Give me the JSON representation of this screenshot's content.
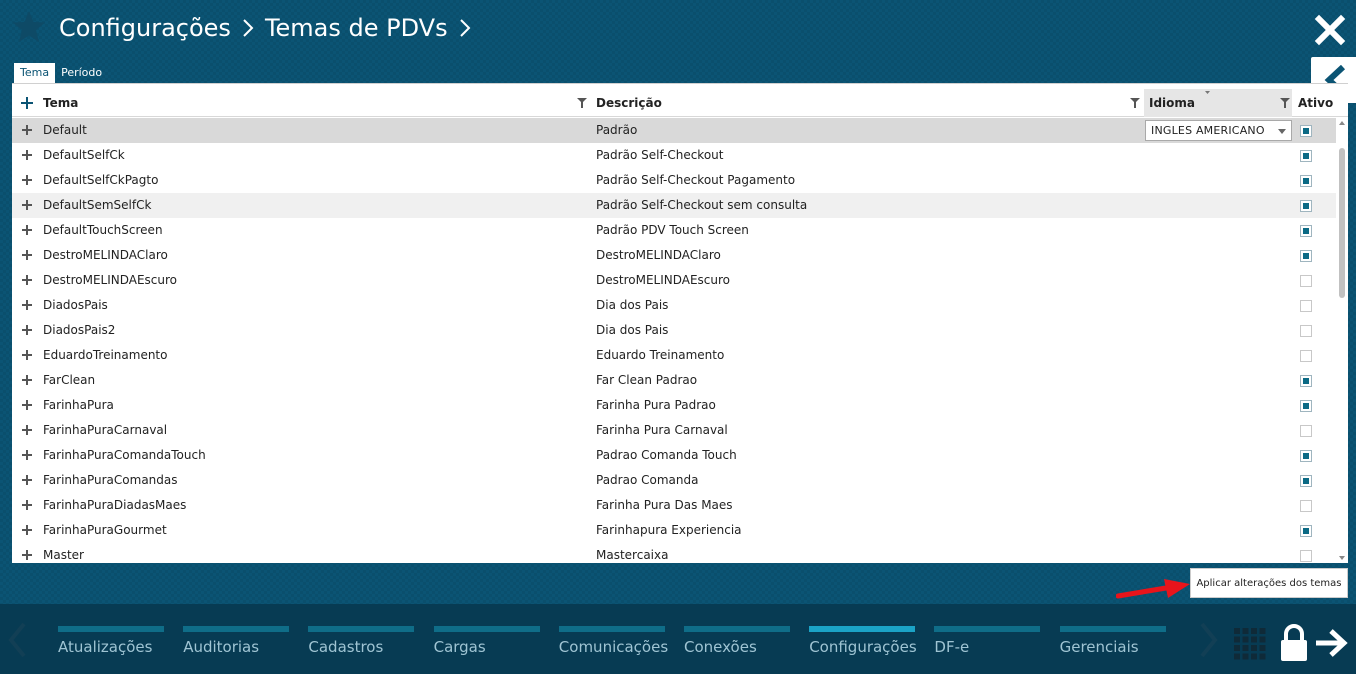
{
  "breadcrumb": {
    "items": [
      "Configurações",
      "Temas de PDVs"
    ]
  },
  "tabs": [
    {
      "label": "Tema",
      "active": true
    },
    {
      "label": "Período",
      "active": false
    }
  ],
  "grid": {
    "columns": {
      "tema": "Tema",
      "descricao": "Descrição",
      "idioma": "Idioma",
      "ativo": "Ativo"
    },
    "selected_idioma": "INGLES AMERICANO",
    "rows": [
      {
        "tema": "Default",
        "descricao": "Padrão",
        "ativo": true
      },
      {
        "tema": "DefaultSelfCk",
        "descricao": "Padrão Self-Checkout",
        "ativo": true
      },
      {
        "tema": "DefaultSelfCkPagto",
        "descricao": "Padrão Self-Checkout Pagamento",
        "ativo": true
      },
      {
        "tema": "DefaultSemSelfCk",
        "descricao": "Padrão Self-Checkout sem consulta",
        "ativo": true
      },
      {
        "tema": "DefaultTouchScreen",
        "descricao": "Padrão PDV Touch Screen",
        "ativo": true
      },
      {
        "tema": "DestroMELINDAClaro",
        "descricao": "DestroMELINDAClaro",
        "ativo": true
      },
      {
        "tema": "DestroMELINDAEscuro",
        "descricao": "DestroMELINDAEscuro",
        "ativo": false
      },
      {
        "tema": "DiadosPais",
        "descricao": "Dia dos Pais",
        "ativo": false
      },
      {
        "tema": "DiadosPais2",
        "descricao": "Dia dos Pais",
        "ativo": false
      },
      {
        "tema": "EduardoTreinamento",
        "descricao": "Eduardo Treinamento",
        "ativo": false
      },
      {
        "tema": "FarClean",
        "descricao": "Far Clean Padrao",
        "ativo": true
      },
      {
        "tema": "FarinhaPura",
        "descricao": "Farinha Pura Padrao",
        "ativo": true
      },
      {
        "tema": "FarinhaPuraCarnaval",
        "descricao": "Farinha Pura Carnaval",
        "ativo": false
      },
      {
        "tema": "FarinhaPuraComandaTouch",
        "descricao": "Padrao Comanda Touch",
        "ativo": true
      },
      {
        "tema": "FarinhaPuraComandas",
        "descricao": "Padrao Comanda",
        "ativo": true
      },
      {
        "tema": "FarinhaPuraDiadasMaes",
        "descricao": "Farinha Pura Das Maes",
        "ativo": false
      },
      {
        "tema": "FarinhaPuraGourmet",
        "descricao": "Farinhapura Experiencia",
        "ativo": true
      },
      {
        "tema": "Master",
        "descricao": "Mastercaixa",
        "ativo": false
      }
    ]
  },
  "apply_button": "Aplicar alterações dos temas",
  "bottom_menu": [
    {
      "label": "Atualizações",
      "active": false
    },
    {
      "label": "Auditorias",
      "active": false
    },
    {
      "label": "Cadastros",
      "active": false
    },
    {
      "label": "Cargas",
      "active": false
    },
    {
      "label": "Comunicações",
      "active": false
    },
    {
      "label": "Conexões",
      "active": false
    },
    {
      "label": "Configurações",
      "active": true
    },
    {
      "label": "DF-e",
      "active": false
    },
    {
      "label": "Gerenciais",
      "active": false
    }
  ],
  "colors": {
    "background": "#0b5474",
    "bottom_bar": "#073b53",
    "accent": "#1ba3c6",
    "check": "#0b6a85",
    "annotation_arrow": "#e8141b"
  }
}
